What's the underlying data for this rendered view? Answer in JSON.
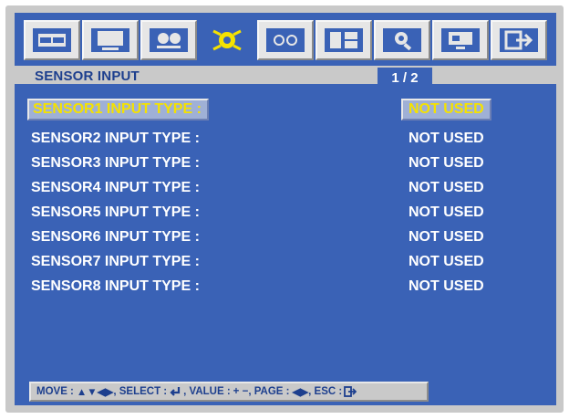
{
  "toolbar": {
    "icons": [
      {
        "name": "display-icon"
      },
      {
        "name": "monitor-icon"
      },
      {
        "name": "camera-icon"
      },
      {
        "name": "sensor-icon",
        "active": true
      },
      {
        "name": "device-icon"
      },
      {
        "name": "record-icon"
      },
      {
        "name": "search-icon"
      },
      {
        "name": "network-icon"
      },
      {
        "name": "exit-icon"
      }
    ]
  },
  "header": {
    "title": "SENSOR INPUT",
    "page": "1 / 2"
  },
  "rows": [
    {
      "label": "SENSOR1 INPUT TYPE :",
      "value": "NOT USED"
    },
    {
      "label": "SENSOR2 INPUT TYPE :",
      "value": "NOT USED"
    },
    {
      "label": "SENSOR3 INPUT TYPE :",
      "value": "NOT USED"
    },
    {
      "label": "SENSOR4 INPUT TYPE :",
      "value": "NOT USED"
    },
    {
      "label": "SENSOR5 INPUT TYPE :",
      "value": "NOT USED"
    },
    {
      "label": "SENSOR6 INPUT TYPE :",
      "value": "NOT USED"
    },
    {
      "label": "SENSOR7 INPUT TYPE :",
      "value": "NOT USED"
    },
    {
      "label": "SENSOR8 INPUT TYPE :",
      "value": "NOT USED"
    }
  ],
  "help": {
    "move": "MOVE :",
    "move_keys": "▲▼◀▶",
    "select": ", SELECT :",
    "value": ", VALUE :",
    "value_keys": "+ −",
    "page": ", PAGE :",
    "page_keys": "◀▶",
    "esc": ", ESC :"
  },
  "colors": {
    "background": "#3a62b6",
    "panel": "#c9c9c9",
    "highlight_text": "#f5e200",
    "text": "#ffffff",
    "title_text": "#1d3f8e"
  }
}
